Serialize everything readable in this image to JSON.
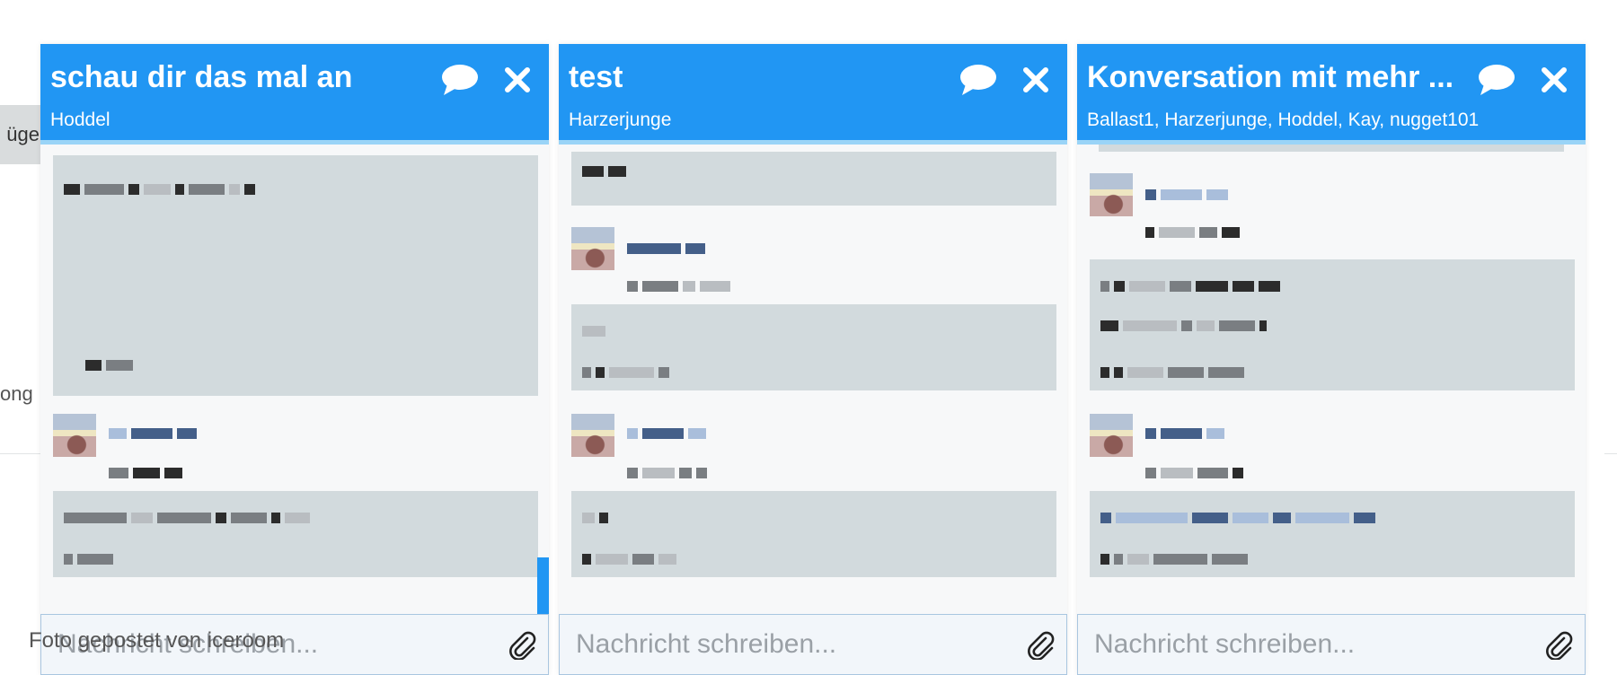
{
  "background": {
    "button_partial": "üge",
    "text_partial": "ong",
    "caption": "Foto gepostet von iceroom"
  },
  "windows": [
    {
      "title": "schau dir das mal an",
      "subtitle": "Hoddel",
      "input_placeholder": "Nachricht schreiben...",
      "icons": {
        "chat": "speech-bubble-icon",
        "close": "close-icon",
        "attach": "paperclip-icon"
      }
    },
    {
      "title": "test",
      "subtitle": "Harzerjunge",
      "input_placeholder": "Nachricht schreiben...",
      "icons": {
        "chat": "speech-bubble-icon",
        "close": "close-icon",
        "attach": "paperclip-icon"
      }
    },
    {
      "title": "Konversation mit mehr ...",
      "subtitle": "Ballast1, Harzerjunge, Hoddel, Kay, nugget101",
      "input_placeholder": "Nachricht schreiben...",
      "icons": {
        "chat": "speech-bubble-icon",
        "close": "close-icon",
        "attach": "paperclip-icon"
      }
    }
  ],
  "colors": {
    "header": "#2196f3",
    "bubble": "#d2dadd",
    "window_bg": "#f7f8f9"
  }
}
